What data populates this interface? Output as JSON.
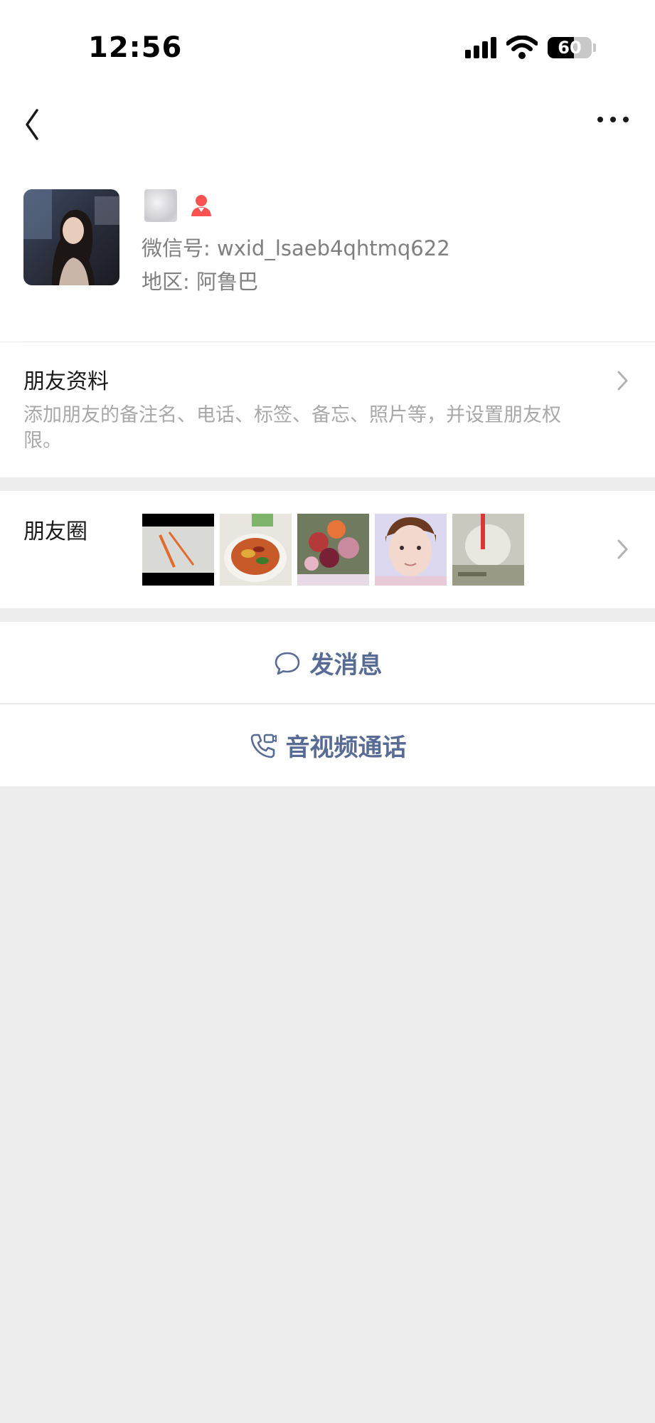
{
  "status_bar": {
    "time": "12:56",
    "battery": "60"
  },
  "nav": {
    "back_icon": "chevron-left-icon",
    "more_icon": "more-dots-icon"
  },
  "profile": {
    "wxid": "微信号: wxid_lsaeb4qhtmq622",
    "region": "地区: 阿鲁巴",
    "gender_icon": "female-user-icon",
    "gender_color": "#fa5151"
  },
  "friend_info": {
    "title": "朋友资料",
    "description": "添加朋友的备注名、电话、标签、备忘、照片等，并设置朋友权限。"
  },
  "moments": {
    "title": "朋友圈",
    "thumbnail_count": 5
  },
  "actions": {
    "message_label": "发消息",
    "call_label": "音视频通话",
    "accent_color": "#576b95"
  }
}
